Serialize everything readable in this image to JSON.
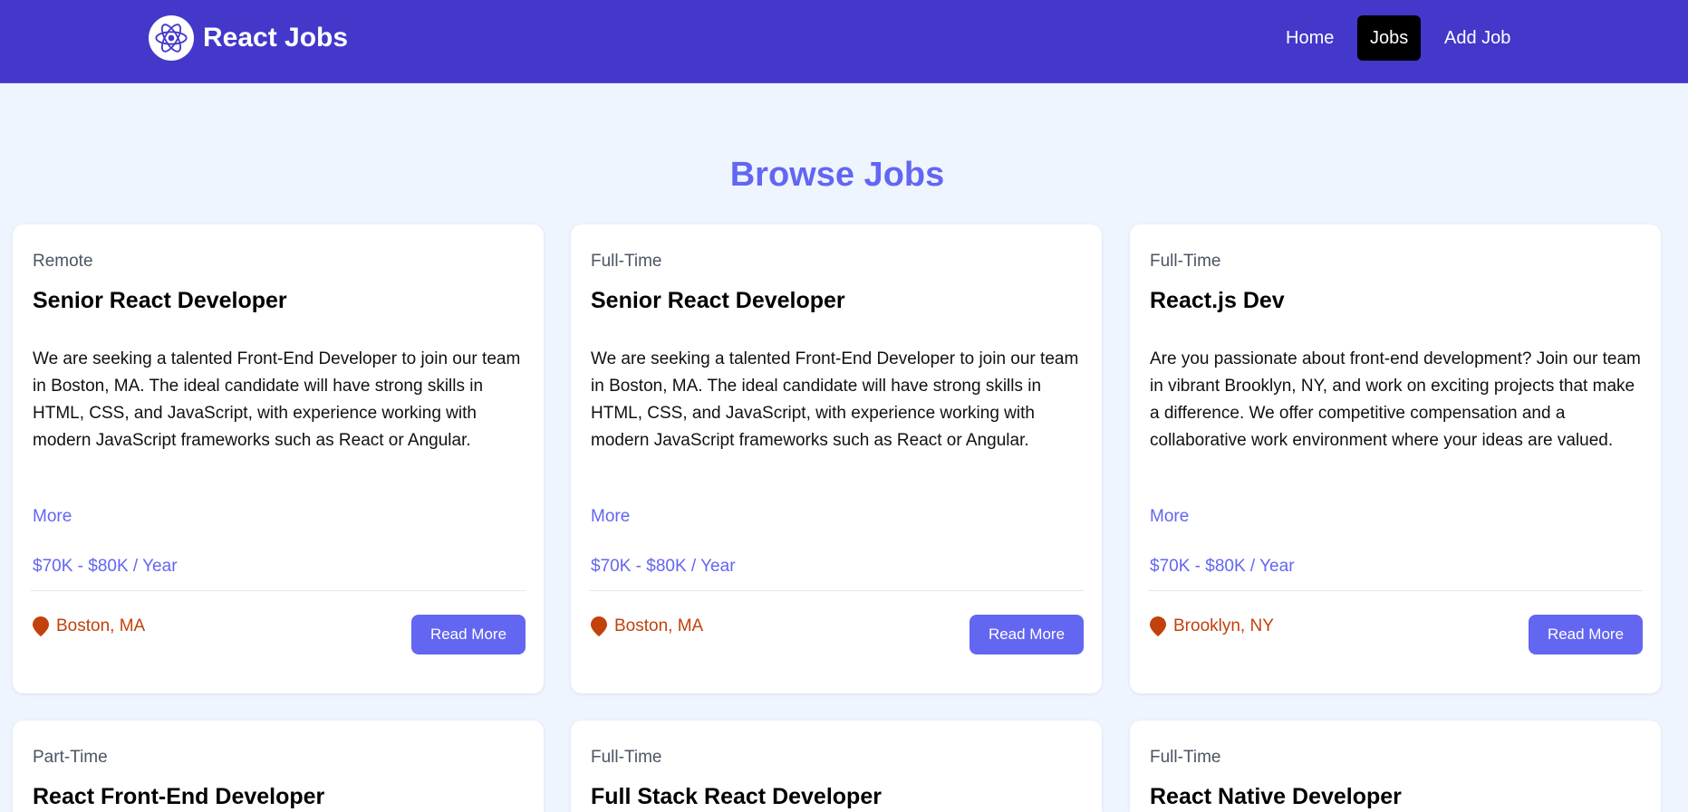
{
  "brand": {
    "name": "React Jobs",
    "icon": "react-atom-icon"
  },
  "nav": {
    "home": "Home",
    "jobs": "Jobs",
    "add_job": "Add Job"
  },
  "page": {
    "title": "Browse Jobs"
  },
  "colors": {
    "nav_bg": "#4338ca",
    "accent": "#6366f1",
    "location": "#c2410c",
    "page_bg": "#eef5ff",
    "active_nav": "#000000"
  },
  "jobs": [
    {
      "type": "Remote",
      "title": "Senior React Developer",
      "description": "We are seeking a talented Front-End Developer to join our team in Boston, MA. The ideal candidate will have strong skills in HTML, CSS, and JavaScript, with experience working with modern JavaScript frameworks such as React or Angular.",
      "more": "More",
      "salary": "$70K - $80K / Year",
      "location": "Boston, MA",
      "button": "Read More"
    },
    {
      "type": "Full-Time",
      "title": "Senior React Developer",
      "description": "We are seeking a talented Front-End Developer to join our team in Boston, MA. The ideal candidate will have strong skills in HTML, CSS, and JavaScript, with experience working with modern JavaScript frameworks such as React or Angular.",
      "more": "More",
      "salary": "$70K - $80K / Year",
      "location": "Boston, MA",
      "button": "Read More"
    },
    {
      "type": "Full-Time",
      "title": "React.js Dev",
      "description": "Are you passionate about front-end development? Join our team in vibrant Brooklyn, NY, and work on exciting projects that make a difference. We offer competitive compensation and a collaborative work environment where your ideas are valued.",
      "more": "More",
      "salary": "$70K - $80K / Year",
      "location": "Brooklyn, NY",
      "button": "Read More"
    },
    {
      "type": "Part-Time",
      "title": "React Front-End Developer"
    },
    {
      "type": "Full-Time",
      "title": "Full Stack React Developer"
    },
    {
      "type": "Full-Time",
      "title": "React Native Developer"
    }
  ]
}
